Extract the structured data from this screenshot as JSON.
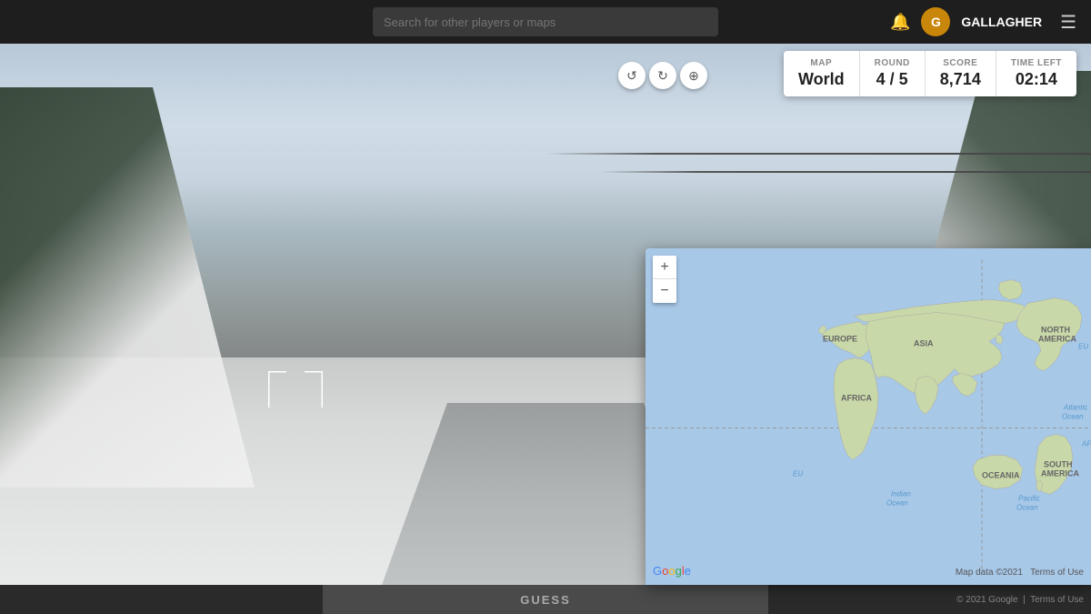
{
  "nav": {
    "search_placeholder": "Search for other players or maps",
    "username": "GALLAGHER",
    "avatar_initial": "G",
    "bell_icon": "🔔",
    "hamburger_icon": "☰"
  },
  "score_panel": {
    "map_label": "MAP",
    "map_value": "World",
    "round_label": "ROUND",
    "round_value": "4 / 5",
    "score_label": "SCORE",
    "score_value": "8,714",
    "time_label": "TIME LEFT",
    "time_value": "02:14"
  },
  "street_controls": {
    "rotate_left": "↺",
    "rotate_right": "↻",
    "zoom_in_street": "⊕"
  },
  "map": {
    "zoom_in": "+",
    "zoom_out": "−",
    "copyright": "Map data ©2021",
    "terms": "Terms of Use",
    "google_label": "Google"
  },
  "bottom": {
    "guess_label": "GUESS",
    "copyright": "© 2021 Google",
    "terms": "Terms of Use"
  }
}
